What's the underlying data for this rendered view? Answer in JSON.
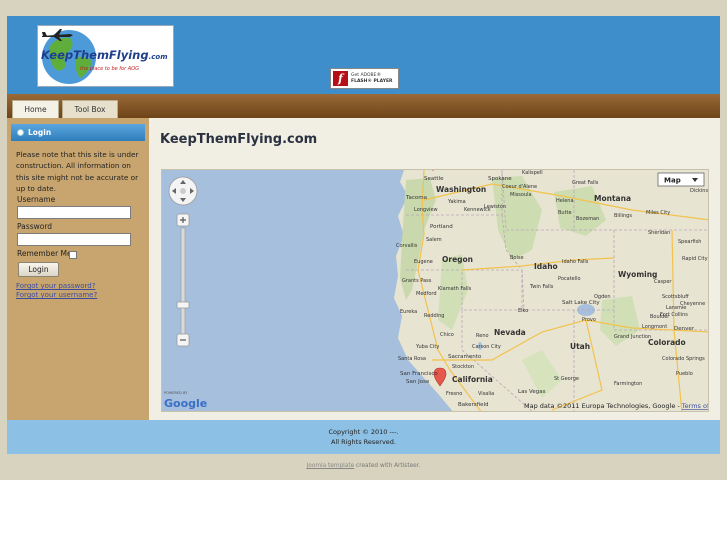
{
  "site": {
    "logo_text": "KeepThemFlying",
    "logo_domain": ".com",
    "logo_tagline": "the place to be for AOG",
    "flash_badge_line1": "Get ADOBE®",
    "flash_badge_line2": "FLASH® PLAYER"
  },
  "nav": {
    "tabs": [
      {
        "label": "Home"
      },
      {
        "label": "Tool Box"
      }
    ]
  },
  "sidebar": {
    "login_title": "Login",
    "notice": "Please note that this site is under construction. All information on this site might not be accurate or up to date.",
    "username_label": "Username",
    "password_label": "Password",
    "remember_label": "Remember Me",
    "login_button": "Login",
    "forgot_password": "Forgot your password?",
    "forgot_username": "Forgot your username?"
  },
  "main": {
    "title": "KeepThemFlying.com"
  },
  "map": {
    "type_button": "Map",
    "powered_by": "POWERED BY",
    "google": "Google",
    "attribution": "Map data ©2011 Europa Technologies, Google - ",
    "terms": "Terms of Use",
    "labels": {
      "washington": "Washington",
      "montana": "Montana",
      "oregon": "Oregon",
      "idaho": "Idaho",
      "wyoming": "Wyoming",
      "nevada": "Nevada",
      "utah": "Utah",
      "california": "California",
      "colorado": "Colorado",
      "seattle": "Seattle",
      "spokane": "Spokane",
      "tacoma": "Tacoma",
      "yakima": "Yakima",
      "kennewick": "Kennewick",
      "portland": "Portland",
      "salem": "Salem",
      "eugene": "Eugene",
      "corvallis": "Corvallis",
      "longview": "Longview",
      "medford": "Medford",
      "klamath_falls": "Klamath Falls",
      "grants_pass": "Grants Pass",
      "eureka": "Eureka",
      "redding": "Redding",
      "chico": "Chico",
      "reno": "Reno",
      "carson_city": "Carson City",
      "sacramento": "Sacramento",
      "yuba_city": "Yuba City",
      "santa_rosa": "Santa Rosa",
      "stockton": "Stockton",
      "san_francisco": "San Francisco",
      "san_jose": "San Jose",
      "fresno": "Fresno",
      "bakersfield": "Bakersfield",
      "visalia": "Visalia",
      "elko": "Elko",
      "boise": "Boise",
      "twin_falls": "Twin Falls",
      "pocatello": "Pocatello",
      "idaho_falls": "Idaho Falls",
      "salt_lake_city": "Salt Lake City",
      "provo": "Provo",
      "ogden": "Ogden",
      "las_vegas": "Las Vegas",
      "st_george": "St George",
      "grand_junction": "Grand Junction",
      "denver": "Denver",
      "boulder": "Boulder",
      "fort_collins": "Fort Collins",
      "colorado_springs": "Colorado Springs",
      "pueblo": "Pueblo",
      "farmington": "Farmington",
      "great_falls": "Great Falls",
      "missoula": "Missoula",
      "helena": "Helena",
      "butte": "Butte",
      "bozeman": "Bozeman",
      "billings": "Billings",
      "miles_city": "Miles City",
      "sheridan": "Sheridan",
      "casper": "Casper",
      "rapid_city": "Rapid City",
      "spearfish": "Spearfish",
      "cheyenne": "Cheyenne",
      "laramie": "Laramie",
      "scottsbluff": "Scottsbluff",
      "dickinson": "Dickins",
      "longmont": "Longmont",
      "lewiston": "Lewiston",
      "coeur_dalene": "Coeur d'Alene",
      "kalispell": "Kalispell"
    }
  },
  "footer": {
    "copyright": "Copyright © 2010 ---.",
    "rights": "All Rights Reserved.",
    "credit_link": "Joomla template",
    "credit_rest": " created with Artisteer."
  }
}
